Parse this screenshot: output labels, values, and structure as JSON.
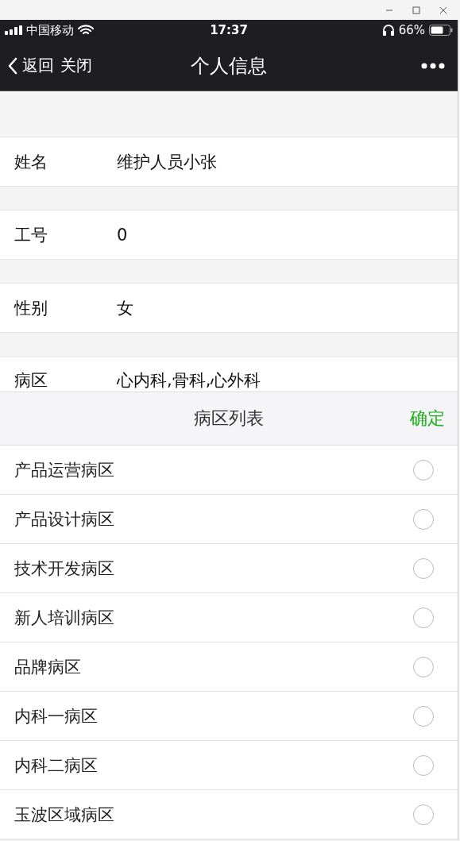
{
  "status_bar": {
    "carrier": "中国移动",
    "time": "17:37",
    "battery": "66%"
  },
  "nav_bar": {
    "back": "返回",
    "close": "关闭",
    "title": "个人信息"
  },
  "fields": [
    {
      "label": "姓名",
      "value": "维护人员小张"
    },
    {
      "label": "工号",
      "value": "0"
    },
    {
      "label": "性别",
      "value": "女"
    },
    {
      "label": "病区",
      "value": "心内科,骨科,心外科"
    }
  ],
  "picker": {
    "title": "病区列表",
    "confirm": "确定",
    "items": [
      {
        "label": "产品运营病区",
        "selected": false
      },
      {
        "label": "产品设计病区",
        "selected": false
      },
      {
        "label": "技术开发病区",
        "selected": false
      },
      {
        "label": "新人培训病区",
        "selected": false
      },
      {
        "label": "品牌病区",
        "selected": false
      },
      {
        "label": "内科一病区",
        "selected": false
      },
      {
        "label": "内科二病区",
        "selected": false
      },
      {
        "label": "玉波区域病区",
        "selected": false
      }
    ]
  }
}
